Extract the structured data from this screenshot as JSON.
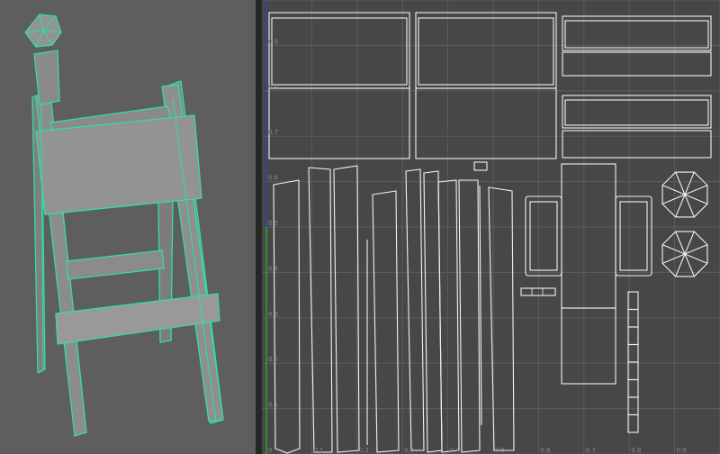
{
  "viewport": {
    "object": "easel-stool-model",
    "background_color": "#5e5e5e",
    "wireframe_color": "#2fe0a2",
    "surface_color": "#8e8e8e"
  },
  "uv_editor": {
    "background_color": "#474747",
    "grid_color": "#5c5c5c",
    "uv_color": "#f2f2f2",
    "v_axis_color": "#3040c8",
    "u_axis_color": "#2aa52a",
    "x_ticks": [
      "0",
      "0.1",
      "0.2",
      "0.3",
      "0.4",
      "0.5",
      "0.6",
      "0.7",
      "0.8",
      "0.9"
    ],
    "y_ticks": [
      "0.9",
      "0.8",
      "0.7",
      "0.6",
      "0.5",
      "0.4",
      "0.3",
      "0.2",
      "0.1"
    ]
  }
}
